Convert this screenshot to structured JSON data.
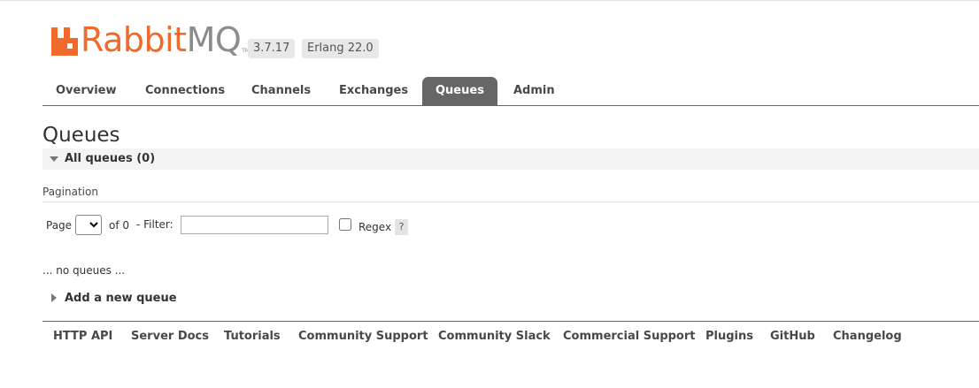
{
  "header": {
    "logo_rabbit": "Rabbit",
    "logo_mq": "MQ",
    "logo_tm": "TM",
    "version": "3.7.17",
    "erlang": "Erlang 22.0"
  },
  "tabs": [
    {
      "label": "Overview"
    },
    {
      "label": "Connections"
    },
    {
      "label": "Channels"
    },
    {
      "label": "Exchanges"
    },
    {
      "label": "Queues",
      "active": true
    },
    {
      "label": "Admin"
    }
  ],
  "page": {
    "title": "Queues",
    "section_title": "All queues (0)",
    "pagination_label": "Pagination",
    "page_label": "Page",
    "of_label": "of 0",
    "filter_label": "- Filter:",
    "filter_value": "",
    "regex_label": "Regex",
    "regex_checked": false,
    "help_label": "?",
    "empty_text": "... no queues ...",
    "add_queue_label": "Add a new queue"
  },
  "footer": {
    "links": [
      "HTTP API",
      "Server Docs",
      "Tutorials",
      "Community Support",
      "Community Slack",
      "Commercial Support",
      "Plugins",
      "GitHub",
      "Changelog"
    ]
  },
  "colors": {
    "brand_orange": "#f06b2b",
    "active_tab": "#666666",
    "logo_grey": "#8c8c8c"
  },
  "icons": {
    "logo": "rabbitmq-logo-icon",
    "section_toggle": "triangle-down-icon",
    "add_queue_toggle": "triangle-right-icon",
    "select_arrow": "chevron-down-icon"
  }
}
